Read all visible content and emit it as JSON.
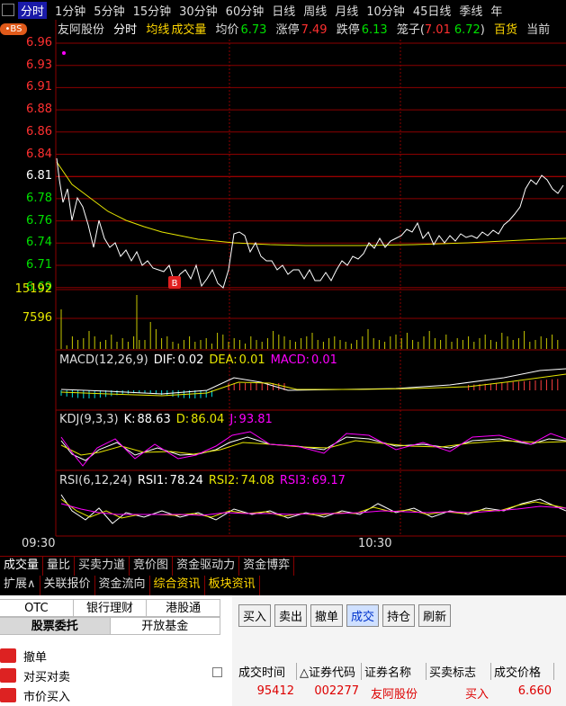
{
  "topbar": {
    "periods": [
      "分时",
      "1分钟",
      "5分钟",
      "15分钟",
      "30分钟",
      "60分钟",
      "日线",
      "周线",
      "月线",
      "10分钟",
      "45日线",
      "季线",
      "年"
    ],
    "active": "分时"
  },
  "bs_badge": "•BS",
  "header": {
    "stock_name": "友阿股份",
    "mode": "分时",
    "avg_line_label": "均线",
    "volume_label": "成交量",
    "avg_price_label": "均价",
    "avg_price": "6.73",
    "limit_up_label": "涨停",
    "limit_up": "7.49",
    "limit_down_label": "跌停",
    "limit_down": "6.13",
    "cage_label": "笼子(",
    "cage_low": "7.01",
    "cage_high": "6.72",
    "cage_close": ")",
    "sector": "百货",
    "current_label": "当前"
  },
  "price_axis": [
    "6.96",
    "6.93",
    "6.91",
    "6.88",
    "6.86",
    "6.84",
    "6.81",
    "6.78",
    "6.76",
    "6.74",
    "6.71",
    "6.69"
  ],
  "volume_axis": [
    "15192",
    "7596"
  ],
  "panels": {
    "macd": {
      "label": "MACD(12,26,9)",
      "dif_label": "DIF:",
      "dif": "0.02",
      "dea_label": "DEA:",
      "dea": "0.01",
      "macd_label": "MACD:",
      "macd": "0.01"
    },
    "kdj": {
      "label": "KDJ(9,3,3)",
      "k_label": "K:",
      "k": "88.63",
      "d_label": "D:",
      "d": "86.04",
      "j_label": "J:",
      "j": "93.81"
    },
    "rsi": {
      "label": "RSI(6,12,24)",
      "rsi1_label": "RSI1:",
      "rsi1": "78.24",
      "rsi2_label": "RSI2:",
      "rsi2": "74.08",
      "rsi3_label": "RSI3:",
      "rsi3": "69.17"
    }
  },
  "time_axis": [
    "09:30",
    "10:30"
  ],
  "tabs_row1": [
    "成交量",
    "量比",
    "买卖力道",
    "竞价图",
    "资金驱动力",
    "资金博弈"
  ],
  "tabs_row2": [
    "扩展∧",
    "关联报价",
    "资金流向",
    "综合资讯",
    "板块资讯"
  ],
  "trade": {
    "left_tabs_row1": [
      "OTC",
      "银行理财",
      "港股通"
    ],
    "left_tabs_row2": [
      "股票委托",
      "开放基金"
    ],
    "commands": [
      "撤单",
      "对买对卖",
      "市价买入"
    ],
    "toolbar": [
      "买入",
      "卖出",
      "撤单",
      "成交",
      "持仓",
      "刷新"
    ],
    "toolbar_selected": "成交",
    "columns": [
      "成交时间",
      "△证券代码",
      "证券名称",
      "买卖标志",
      "成交价格"
    ],
    "rows": [
      {
        "time": "95412",
        "code": "002277",
        "name": "友阿股份",
        "side": "买入",
        "price": "6.660"
      }
    ]
  },
  "colors": {
    "up": "#ff3030",
    "down": "#00e000",
    "avg": "#e6e600",
    "price": "#ffffff",
    "grid": "#8b0000",
    "magenta": "#ff00ff"
  }
}
